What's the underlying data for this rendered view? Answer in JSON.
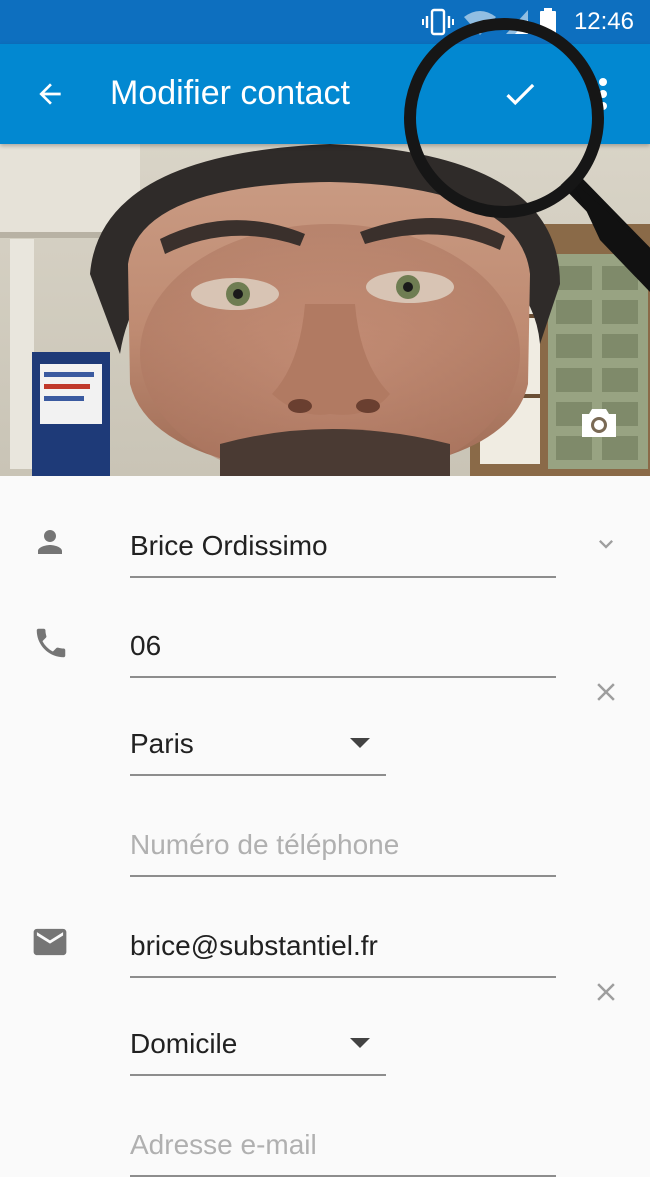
{
  "status_bar": {
    "time": "12:46",
    "icons": [
      "vibrate-icon",
      "wifi-icon",
      "signal-icon",
      "battery-icon"
    ]
  },
  "app_bar": {
    "title": "Modifier contact",
    "back_icon": "arrow-back-icon",
    "save_icon": "check-icon",
    "more_icon": "more-vert-icon",
    "color": "#0288d1",
    "status_color": "#0d6fbf"
  },
  "photo": {
    "camera_icon": "camera-icon"
  },
  "form": {
    "name": {
      "icon": "person-icon",
      "value": "Brice Ordissimo",
      "expand_icon": "chevron-down-icon"
    },
    "phone": {
      "icon": "phone-icon",
      "value": "06",
      "type_label": "Paris",
      "clear_icon": "close-icon",
      "new_placeholder": "Numéro de téléphone"
    },
    "email": {
      "icon": "email-icon",
      "value": "brice@substantiel.fr",
      "type_label": "Domicile",
      "clear_icon": "close-icon",
      "new_placeholder": "Adresse e-mail"
    }
  }
}
